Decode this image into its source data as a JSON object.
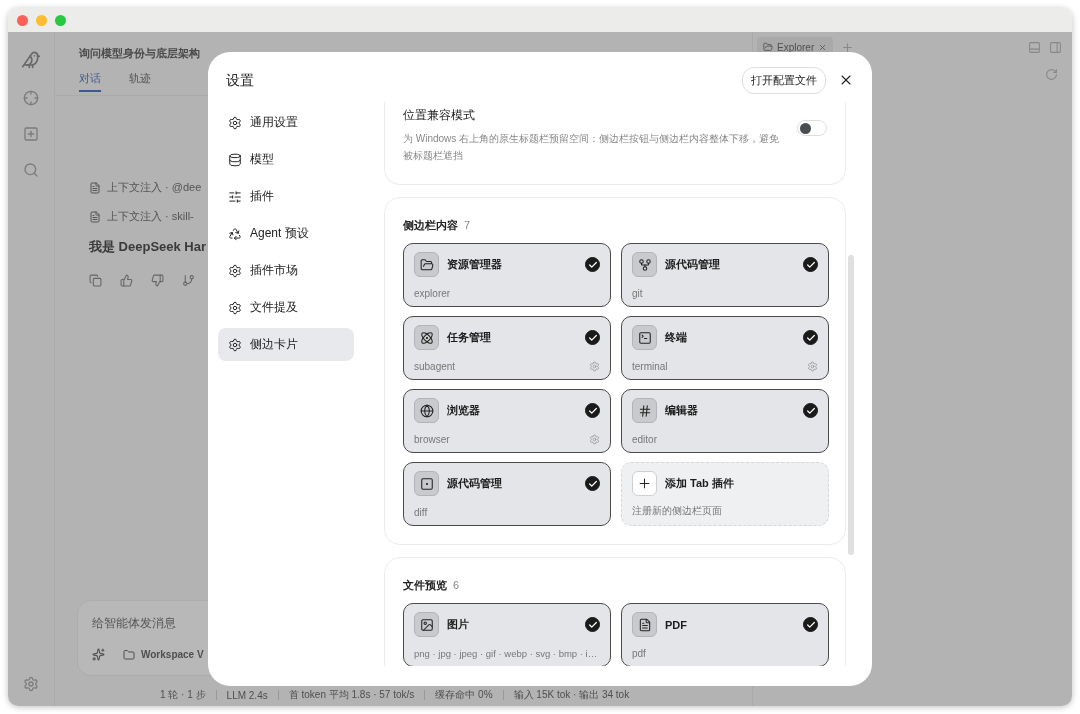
{
  "app": {
    "title": "询问模型身份与底层架构",
    "tabs": [
      {
        "label": "对话",
        "selected": true
      },
      {
        "label": "轨迹",
        "selected": false
      }
    ],
    "messages": [
      {
        "kind": "context",
        "text": "上下文注入 · @dee"
      },
      {
        "kind": "context",
        "text": "上下文注入 · skill-"
      },
      {
        "kind": "reply",
        "text": "我是 DeepSeek Har"
      }
    ],
    "composer": {
      "placeholder": "给智能体发消息",
      "workspace": "Workspace V"
    },
    "status_bar": [
      "1 轮 · 1 步",
      "LLM 2.4s",
      "首 token 平均 1.8s · 57 tok/s",
      "缓存命中 0%",
      "输入 15K tok · 输出 34 tok"
    ],
    "side_panel": {
      "tabs": [
        {
          "label": "Explorer"
        }
      ]
    }
  },
  "settings": {
    "title": "设置",
    "open_config_button": "打开配置文件",
    "nav": [
      {
        "label": "通用设置",
        "selected": false
      },
      {
        "label": "模型",
        "selected": false
      },
      {
        "label": "插件",
        "selected": false
      },
      {
        "label": "Agent 预设",
        "selected": false
      },
      {
        "label": "插件市场",
        "selected": false
      },
      {
        "label": "文件提及",
        "selected": false
      },
      {
        "label": "侧边卡片",
        "selected": true
      }
    ],
    "compat": {
      "title": "位置兼容模式",
      "description": "为 Windows 右上角的原生标题栏预留空间：侧边栏按钮与侧边栏内容整体下移，避免被标题栏遮挡",
      "on": false
    },
    "sections": [
      {
        "title": "侧边栏内容",
        "count": "7",
        "tiles": [
          {
            "kind": "tab",
            "title": "资源管理器",
            "subtitle": "explorer",
            "enabled": true,
            "configurable": false
          },
          {
            "kind": "tab",
            "title": "源代码管理",
            "subtitle": "git",
            "enabled": true,
            "configurable": false
          },
          {
            "kind": "tab",
            "title": "任务管理",
            "subtitle": "subagent",
            "enabled": true,
            "configurable": true
          },
          {
            "kind": "tab",
            "title": "终端",
            "subtitle": "terminal",
            "enabled": true,
            "configurable": true
          },
          {
            "kind": "tab",
            "title": "浏览器",
            "subtitle": "browser",
            "enabled": true,
            "configurable": true
          },
          {
            "kind": "tab",
            "title": "编辑器",
            "subtitle": "editor",
            "enabled": true,
            "configurable": false
          },
          {
            "kind": "tab",
            "title": "源代码管理",
            "subtitle": "diff",
            "enabled": true,
            "configurable": false
          },
          {
            "kind": "add",
            "title": "添加 Tab 插件",
            "subtitle": "注册新的侧边栏页面"
          }
        ]
      },
      {
        "title": "文件预览",
        "count": "6",
        "tiles": [
          {
            "kind": "tab",
            "title": "图片",
            "subtitle": "png · jpg · jpeg · gif · webp · svg · bmp · i…",
            "enabled": true,
            "configurable": false
          },
          {
            "kind": "tab",
            "title": "PDF",
            "subtitle": "pdf",
            "enabled": true,
            "configurable": false
          }
        ]
      }
    ]
  }
}
